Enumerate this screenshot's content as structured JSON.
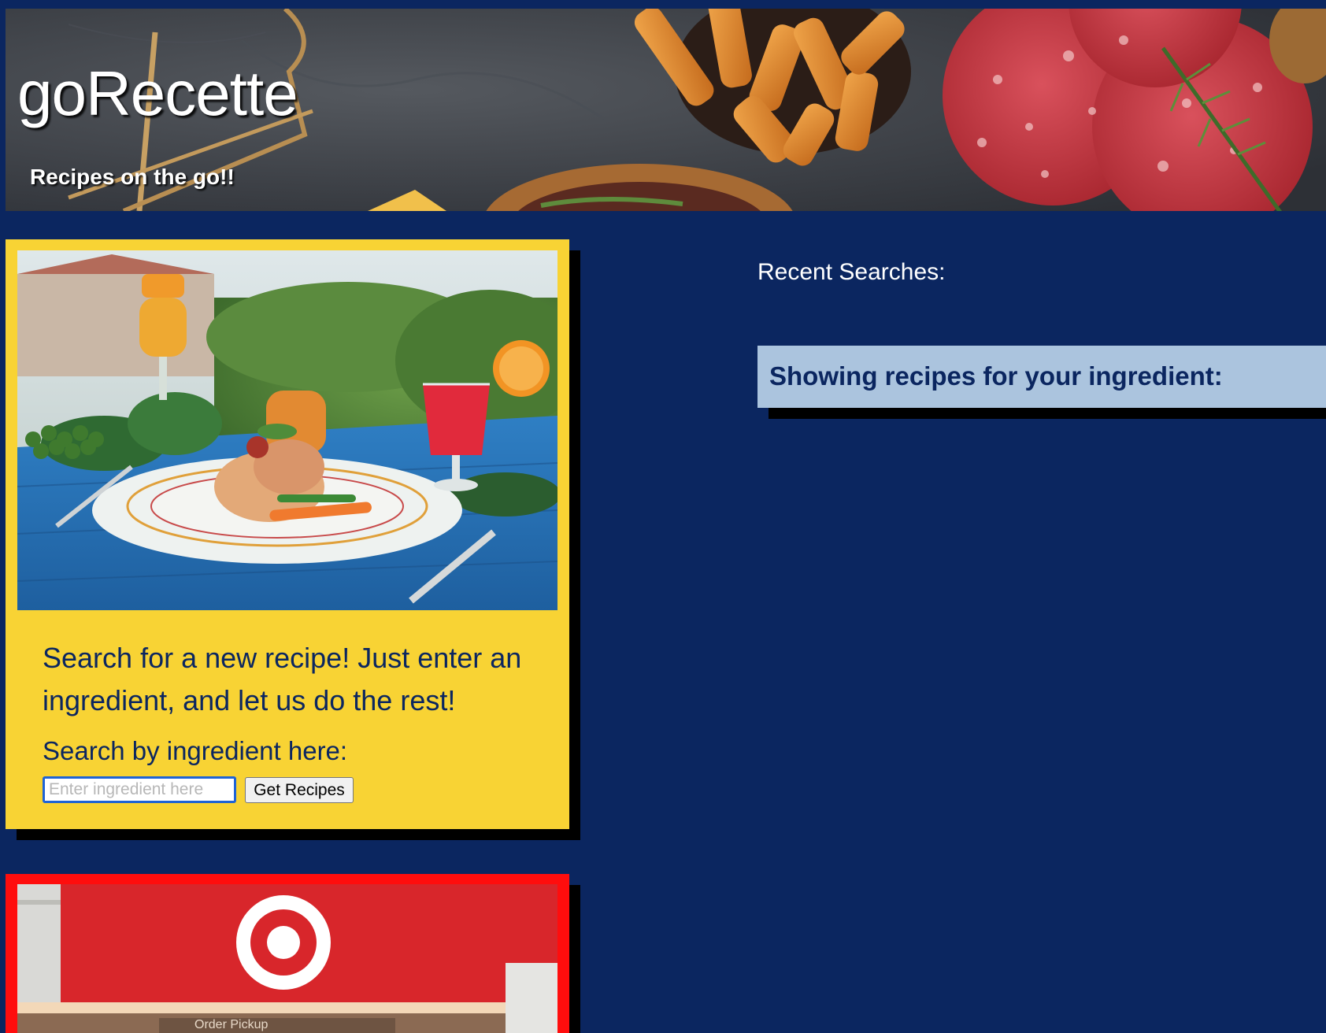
{
  "header": {
    "title": "goRecette",
    "tagline": "Recipes on the go!!"
  },
  "search_card": {
    "description": "Search for a new recipe! Just enter an ingredient, and let us do the rest!",
    "label": "Search by ingredient here:",
    "input_value": "",
    "input_placeholder": "Enter ingredient here",
    "button_label": "Get Recipes"
  },
  "store_card": {
    "sign_text": "Order Pickup"
  },
  "sidebar": {
    "recent_title": "Recent Searches:",
    "recent_items": [],
    "results_title": "Showing recipes for your ingredient:"
  },
  "colors": {
    "page_background": "#0b2660",
    "card_yellow": "#f8d334",
    "card_red": "#ff0d0d",
    "results_box": "#abc4de",
    "heading_text": "#0b2660"
  }
}
